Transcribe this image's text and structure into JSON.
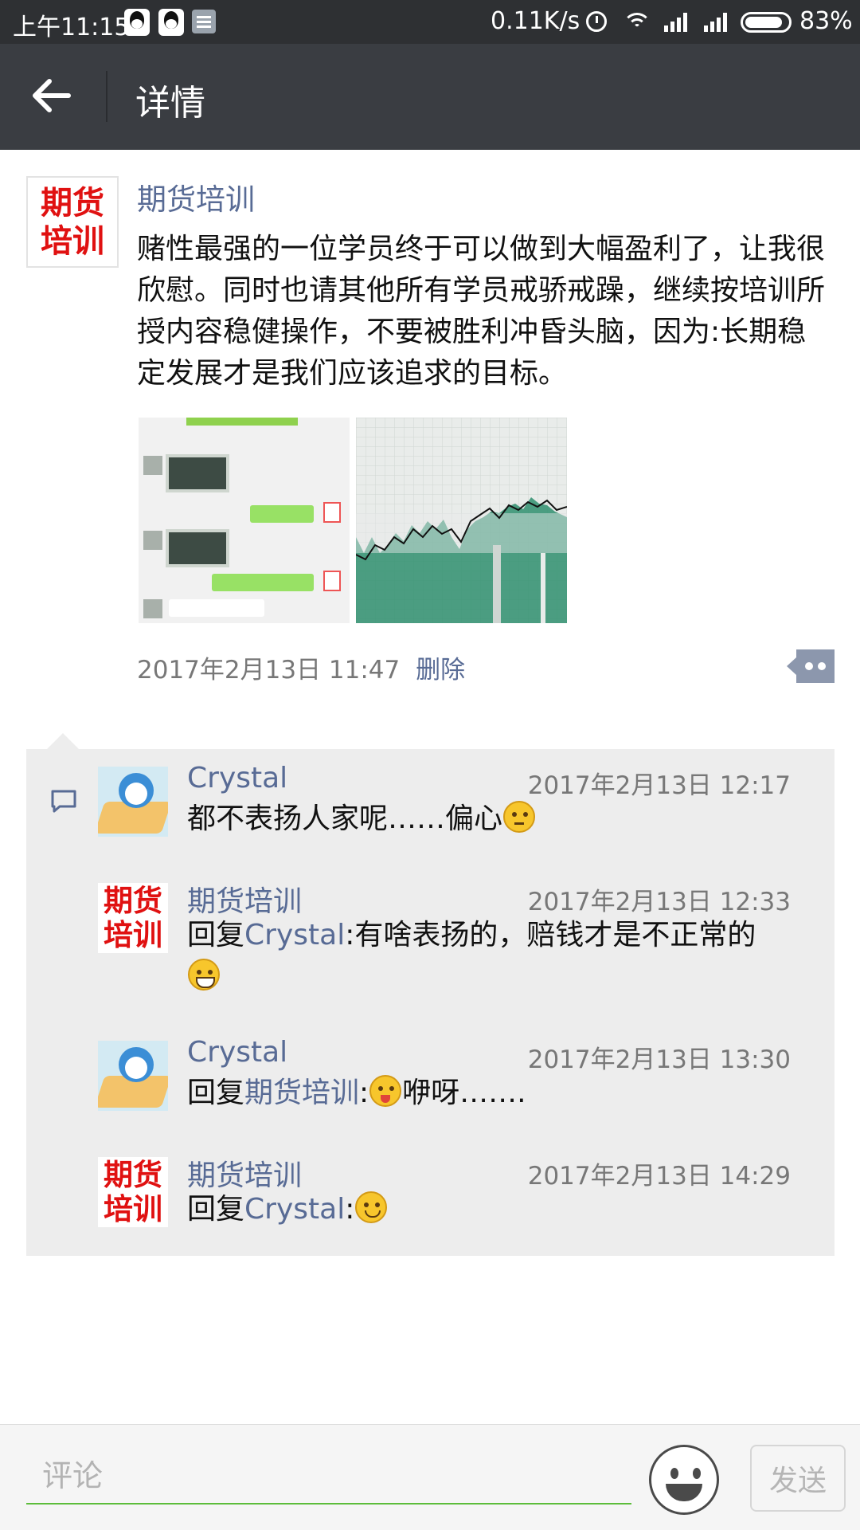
{
  "status_bar": {
    "time": "上午11:15",
    "network_speed": "0.11K/s",
    "battery": "83%"
  },
  "header": {
    "title": "详情"
  },
  "post": {
    "author": "期货培训",
    "avatar_text_line1": "期货",
    "avatar_text_line2": "培训",
    "text": "赌性最强的一位学员终于可以做到大幅盈利了，让我很欣慰。同时也请其他所有学员戒骄戒躁，继续按培训所授内容稳健操作，不要被胜利冲昏头脑，因为:长期稳定发展才是我们应该追求的目标。",
    "timestamp": "2017年2月13日 11:47",
    "delete_label": "删除"
  },
  "comments": [
    {
      "author": "Crystal",
      "time": "2017年2月13日 12:17",
      "text": "都不表扬人家呢……偏心",
      "emoji": "thinking-emoji"
    },
    {
      "author": "期货培训",
      "time": "2017年2月13日 12:33",
      "reply_prefix": "回复",
      "reply_to": "Crystal",
      "text": ":有啥表扬的，赔钱才是不正常的",
      "emoji": "grin-emoji"
    },
    {
      "author": "Crystal",
      "time": "2017年2月13日 13:30",
      "reply_prefix": "回复",
      "reply_to": "期货培训",
      "text_before": ":",
      "text": "咿呀…….",
      "emoji": "wink-emoji"
    },
    {
      "author": "期货培训",
      "time": "2017年2月13日 14:29",
      "reply_prefix": "回复",
      "reply_to": "Crystal",
      "text": ":",
      "emoji": "smile-emoji"
    }
  ],
  "bottom_bar": {
    "input_placeholder": "评论",
    "send_label": "发送"
  },
  "colors": {
    "link": "#586b95",
    "accent_green": "#5cbd3a",
    "header_bg": "#3a3d42",
    "status_bar_bg": "#2e3033"
  }
}
